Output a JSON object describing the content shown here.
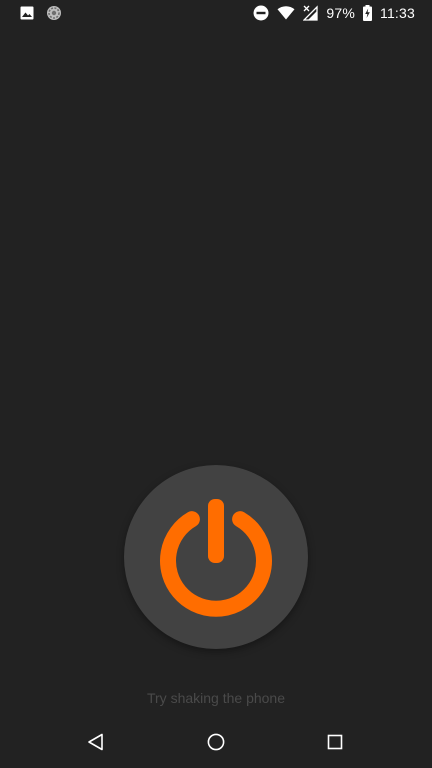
{
  "status_bar": {
    "left_icons": [
      "image-notification-icon",
      "spinner-notification-icon"
    ],
    "right_icons": [
      "do-not-disturb-icon",
      "wifi-icon",
      "no-signal-icon",
      "battery-charging-icon"
    ],
    "battery_percent": "97%",
    "clock": "11:33"
  },
  "main": {
    "power_button_icon": "power-icon",
    "accent_color": "#ff6d00",
    "button_color": "#424242",
    "background_color": "#222222",
    "hint": "Try shaking the phone"
  },
  "nav_bar": {
    "items": [
      "back-icon",
      "home-icon",
      "recents-icon"
    ]
  }
}
